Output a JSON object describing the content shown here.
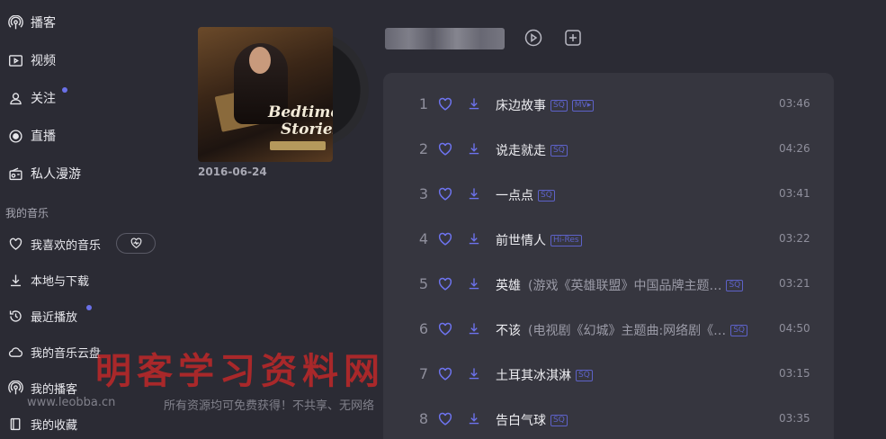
{
  "sidebar": {
    "items": [
      {
        "label": "播客",
        "icon": "podcast-icon"
      },
      {
        "label": "视频",
        "icon": "video-icon"
      },
      {
        "label": "关注",
        "icon": "user-icon",
        "badge": true
      },
      {
        "label": "直播",
        "icon": "live-icon"
      },
      {
        "label": "私人漫游",
        "icon": "radio-icon"
      }
    ],
    "section_title": "我的音乐",
    "music_items": [
      {
        "label": "我喜欢的音乐",
        "icon": "heart-icon"
      },
      {
        "label": "本地与下载",
        "icon": "download-icon"
      },
      {
        "label": "最近播放",
        "icon": "history-icon",
        "badge": true
      },
      {
        "label": "我的音乐云盘",
        "icon": "cloud-icon"
      },
      {
        "label": "我的播客",
        "icon": "podcast-icon"
      },
      {
        "label": "我的收藏",
        "icon": "collection-icon"
      }
    ]
  },
  "album": {
    "cover_text_line1": "Bedtime",
    "cover_text_line2": "Stories",
    "release_date": "2016-06-24"
  },
  "tracks": [
    {
      "num": "1",
      "title": "床边故事",
      "subtitle": "",
      "tags": [
        "SQ",
        "MV▸"
      ],
      "duration": "03:46"
    },
    {
      "num": "2",
      "title": "说走就走",
      "subtitle": "",
      "tags": [
        "SQ"
      ],
      "duration": "04:26"
    },
    {
      "num": "3",
      "title": "一点点",
      "subtitle": "",
      "tags": [
        "SQ"
      ],
      "duration": "03:41"
    },
    {
      "num": "4",
      "title": "前世情人",
      "subtitle": "",
      "tags": [
        "Hi-Res"
      ],
      "duration": "03:22"
    },
    {
      "num": "5",
      "title": "英雄",
      "subtitle": "(游戏《英雄联盟》中国品牌主题…",
      "tags": [
        "SQ"
      ],
      "duration": "03:21"
    },
    {
      "num": "6",
      "title": "不该",
      "subtitle": "(电视剧《幻城》主题曲:网络剧《…",
      "tags": [
        "SQ"
      ],
      "duration": "04:50"
    },
    {
      "num": "7",
      "title": "土耳其冰淇淋",
      "subtitle": "",
      "tags": [
        "SQ"
      ],
      "duration": "03:15"
    },
    {
      "num": "8",
      "title": "告白气球",
      "subtitle": "",
      "tags": [
        "SQ"
      ],
      "duration": "03:35"
    }
  ],
  "watermark": {
    "title": "明客学习资料网",
    "url": "www.leobba.cn",
    "note": "所有资源均可免费获得！不共享、无网络"
  },
  "colors": {
    "background": "#2b2b34",
    "panel": "#36363f",
    "accent": "#6d73ee",
    "watermark": "#cd2828"
  }
}
